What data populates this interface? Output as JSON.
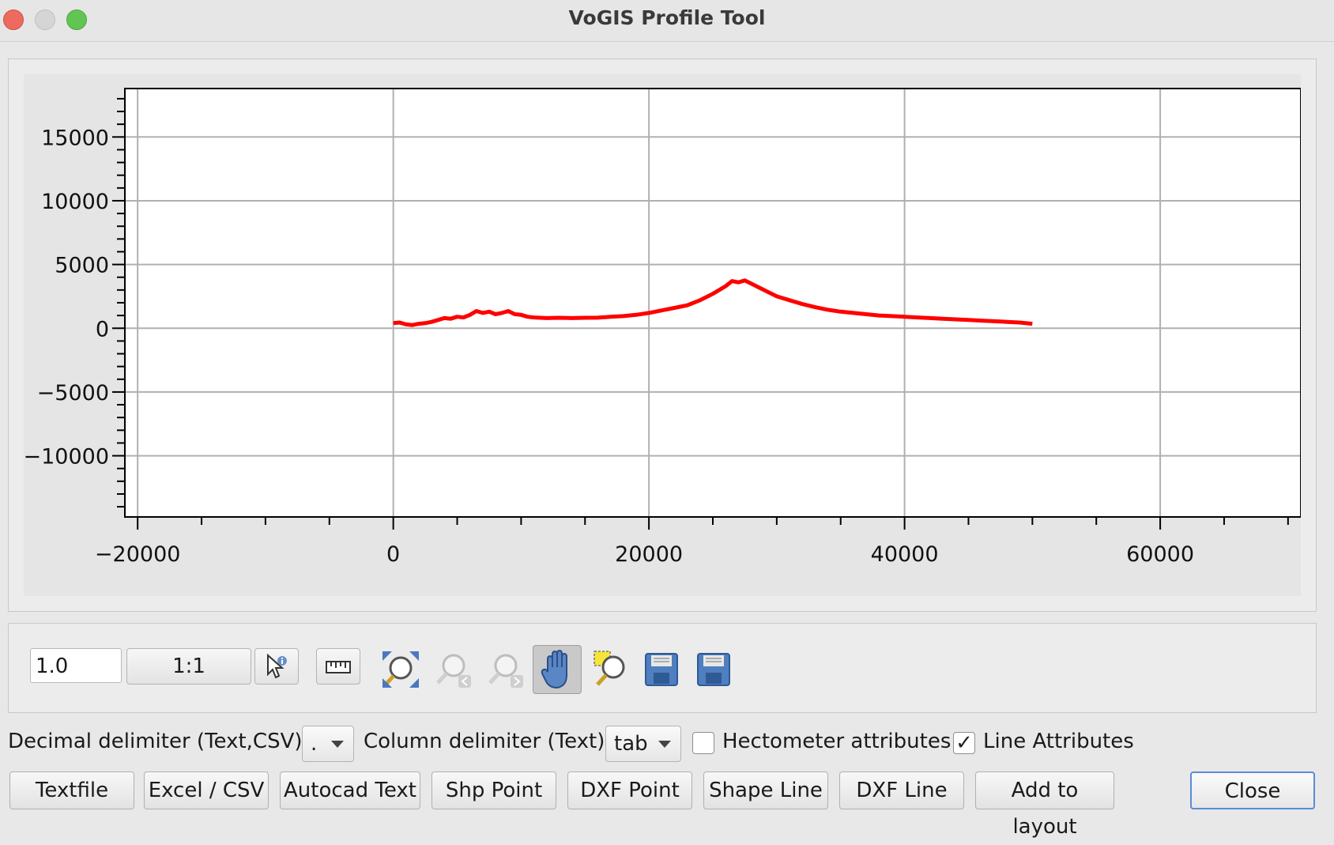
{
  "window": {
    "title": "VoGIS Profile Tool"
  },
  "colors": {
    "profile_line": "#ff0000",
    "grid": "#b0b0b0",
    "accent": "#5b8bd8"
  },
  "chart_data": {
    "type": "line",
    "xlim": [
      -21000,
      71000
    ],
    "ylim": [
      -14800,
      18800
    ],
    "x_ticks": [
      -20000,
      0,
      20000,
      40000,
      60000
    ],
    "x_tick_labels": [
      "−20000",
      "0",
      "20000",
      "40000",
      "60000"
    ],
    "y_ticks": [
      15000,
      10000,
      5000,
      0,
      -5000,
      -10000
    ],
    "y_tick_labels": [
      "15000",
      "10000",
      "5000",
      "0",
      "−5000",
      "−10000"
    ],
    "grid": true,
    "series": [
      {
        "x": [
          0,
          500,
          1000,
          1500,
          2000,
          2500,
          3000,
          3500,
          4000,
          4500,
          5000,
          5500,
          6000,
          6500,
          7000,
          7500,
          8000,
          8500,
          9000,
          9500,
          10000,
          10500,
          11000,
          12000,
          13000,
          14000,
          15000,
          16000,
          17000,
          18000,
          19000,
          20000,
          21000,
          22000,
          23000,
          24000,
          25000,
          26000,
          26500,
          27000,
          27500,
          28000,
          29000,
          30000,
          31000,
          32000,
          33000,
          34000,
          35000,
          36000,
          37000,
          38000,
          39000,
          40000,
          41000,
          42000,
          43000,
          44000,
          45000,
          46000,
          47000,
          48000,
          49000,
          50000
        ],
        "y": [
          400,
          450,
          300,
          250,
          350,
          400,
          500,
          650,
          800,
          750,
          900,
          850,
          1050,
          1350,
          1200,
          1300,
          1100,
          1200,
          1350,
          1100,
          1050,
          900,
          850,
          800,
          820,
          800,
          820,
          830,
          900,
          950,
          1050,
          1200,
          1400,
          1600,
          1800,
          2200,
          2700,
          3300,
          3700,
          3600,
          3750,
          3500,
          3000,
          2500,
          2200,
          1900,
          1650,
          1450,
          1300,
          1200,
          1100,
          1000,
          950,
          900,
          850,
          800,
          750,
          700,
          650,
          600,
          550,
          500,
          450,
          350
        ]
      }
    ]
  },
  "toolbar": {
    "exaggeration_value": "1.0",
    "scale_label": "1:1",
    "icons": [
      "identify-icon",
      "measure-icon",
      "zoom-full-icon",
      "zoom-back-icon",
      "zoom-forward-icon",
      "pan-icon",
      "zoom-rect-icon",
      "save-icon",
      "save-as-icon"
    ]
  },
  "options": {
    "decimal_label": "Decimal delimiter (Text,CSV):",
    "decimal_value": ".",
    "column_label": "Column delimiter (Text):",
    "column_value": "tab",
    "hectometer_label": "Hectometer attributes",
    "hectometer_checked": false,
    "line_attr_label": "Line Attributes",
    "line_attr_checked": true,
    "check_mark": "✓"
  },
  "buttons": {
    "textfile": "Textfile",
    "excel_csv": "Excel / CSV",
    "autocad": "Autocad Text",
    "shp_point": "Shp Point",
    "dxf_point": "DXF Point",
    "shape_line": "Shape Line",
    "dxf_line": "DXF Line",
    "add_layout": "Add to layout",
    "close": "Close"
  }
}
